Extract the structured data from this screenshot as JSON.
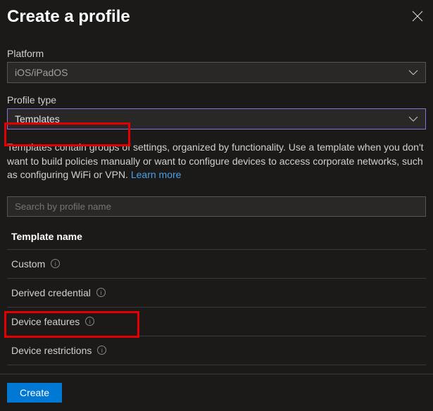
{
  "header": {
    "title": "Create a profile"
  },
  "platform": {
    "label": "Platform",
    "value": "iOS/iPadOS"
  },
  "profileType": {
    "label": "Profile type",
    "value": "Templates"
  },
  "description": {
    "text": "Templates contain groups of settings, organized by functionality. Use a template when you don't want to build policies manually or want to configure devices to access corporate networks, such as configuring WiFi or VPN. ",
    "learnMore": "Learn more"
  },
  "search": {
    "placeholder": "Search by profile name"
  },
  "table": {
    "header": "Template name",
    "rows": [
      {
        "name": "Custom"
      },
      {
        "name": "Derived credential"
      },
      {
        "name": "Device features"
      },
      {
        "name": "Device restrictions"
      }
    ]
  },
  "footer": {
    "createLabel": "Create"
  }
}
